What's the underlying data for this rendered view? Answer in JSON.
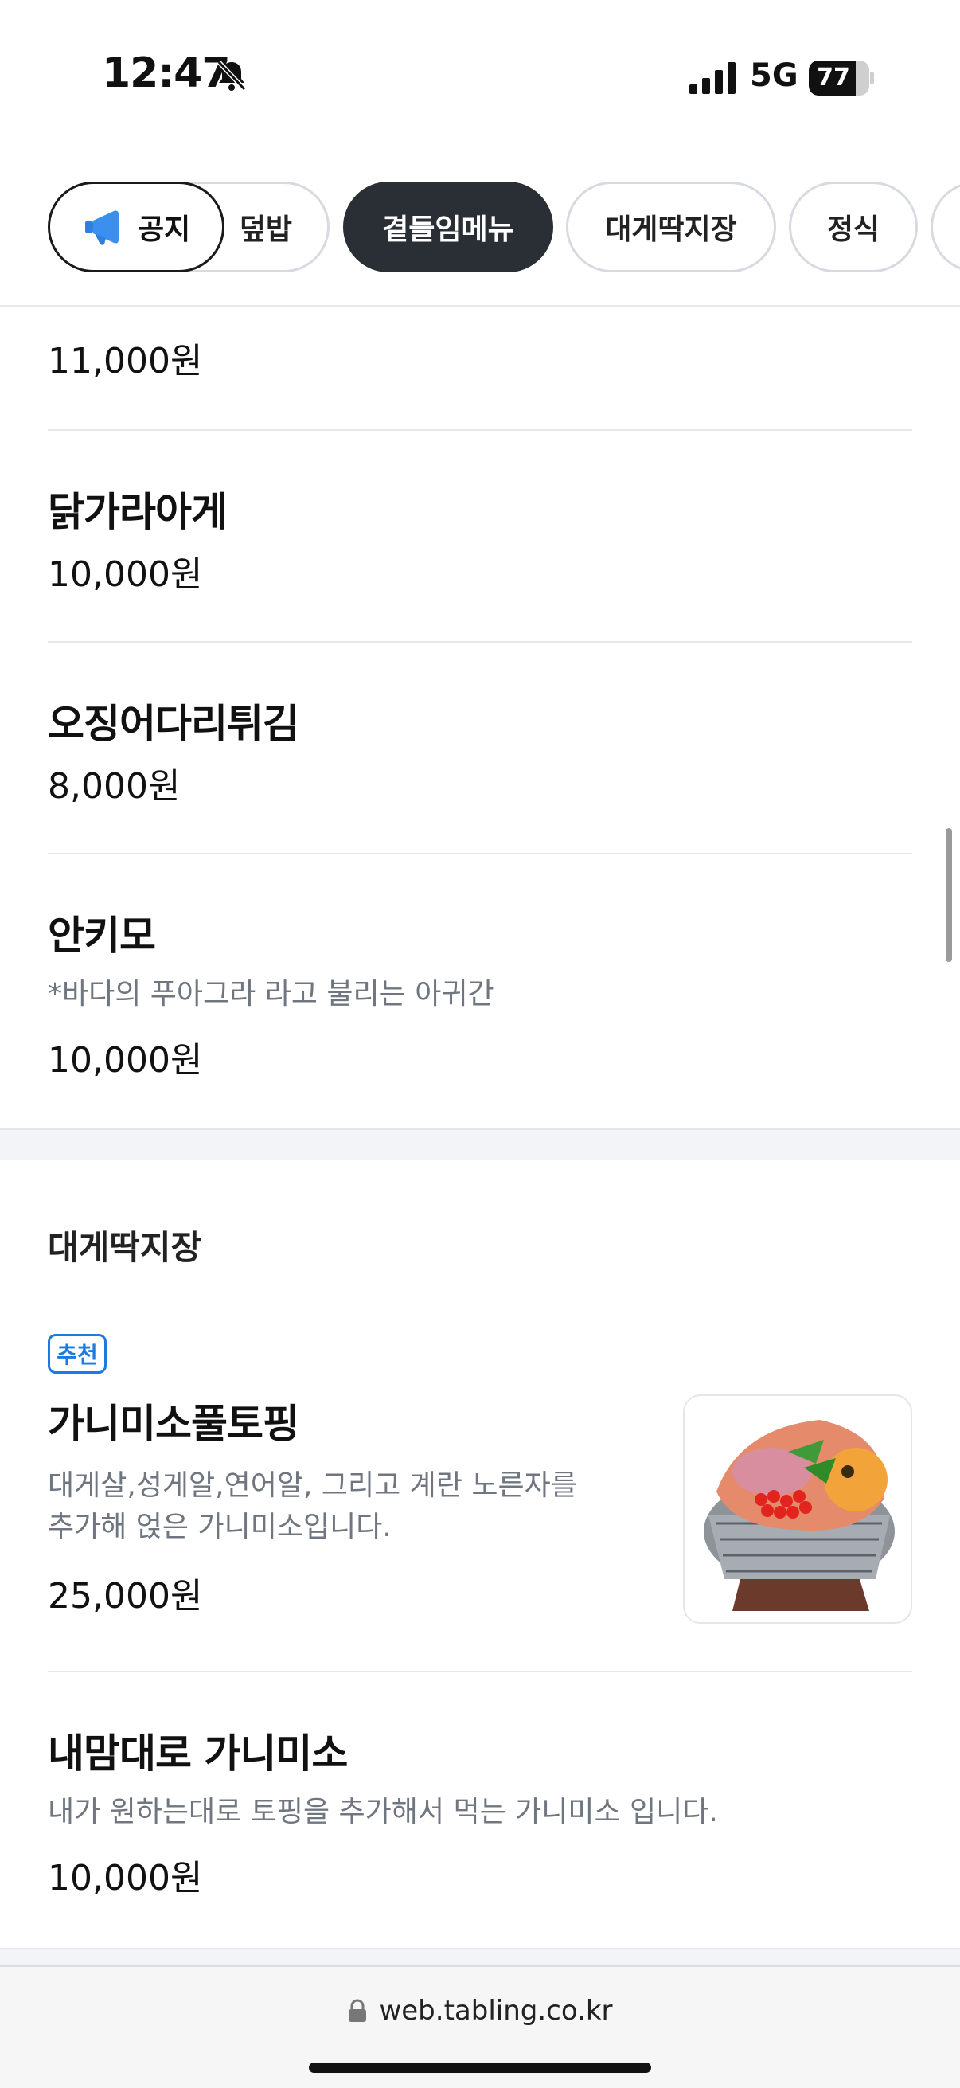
{
  "status_bar": {
    "time": "12:47",
    "network": "5G",
    "battery_percent": "77",
    "battery_level": 0.77,
    "icons": [
      "bell-slash-icon",
      "signal-icon",
      "battery-icon"
    ]
  },
  "tabs": {
    "notice_label": "공지",
    "items": [
      {
        "label": "덮밥",
        "full_label_partially_hidden": true
      },
      {
        "label": "곁들임메뉴",
        "active": true
      },
      {
        "label": "대게딱지장"
      },
      {
        "label": "정식"
      }
    ]
  },
  "menu_top": [
    {
      "price": "11,000원"
    },
    {
      "name": "닭가라아게",
      "price": "10,000원"
    },
    {
      "name": "오징어다리튀김",
      "price": "8,000원"
    },
    {
      "name": "안키모",
      "description": "*바다의 푸아그라 라고 불리는 아귀간",
      "price": "10,000원"
    }
  ],
  "section": {
    "title": "대게딱지장",
    "items": [
      {
        "badge": "추천",
        "name": "가니미소풀토핑",
        "description_line1": "대게살,성게알,연어알, 그리고 계란 노른자를",
        "description_line2": "추가해 얹은 가니미소입니다.",
        "price": "25,000원"
      },
      {
        "name": "내맘대로 가니미소",
        "description": "내가 원하는대로 토핑을 추가해서 먹는 가니미소 입니다.",
        "price": "10,000원"
      }
    ]
  },
  "browser": {
    "url": "web.tabling.co.kr"
  },
  "colors": {
    "active_tab": "#2a2e35",
    "badge_blue": "#1b7be0",
    "section_gap": "#f2f4f7",
    "muted_text": "#6f7680"
  }
}
